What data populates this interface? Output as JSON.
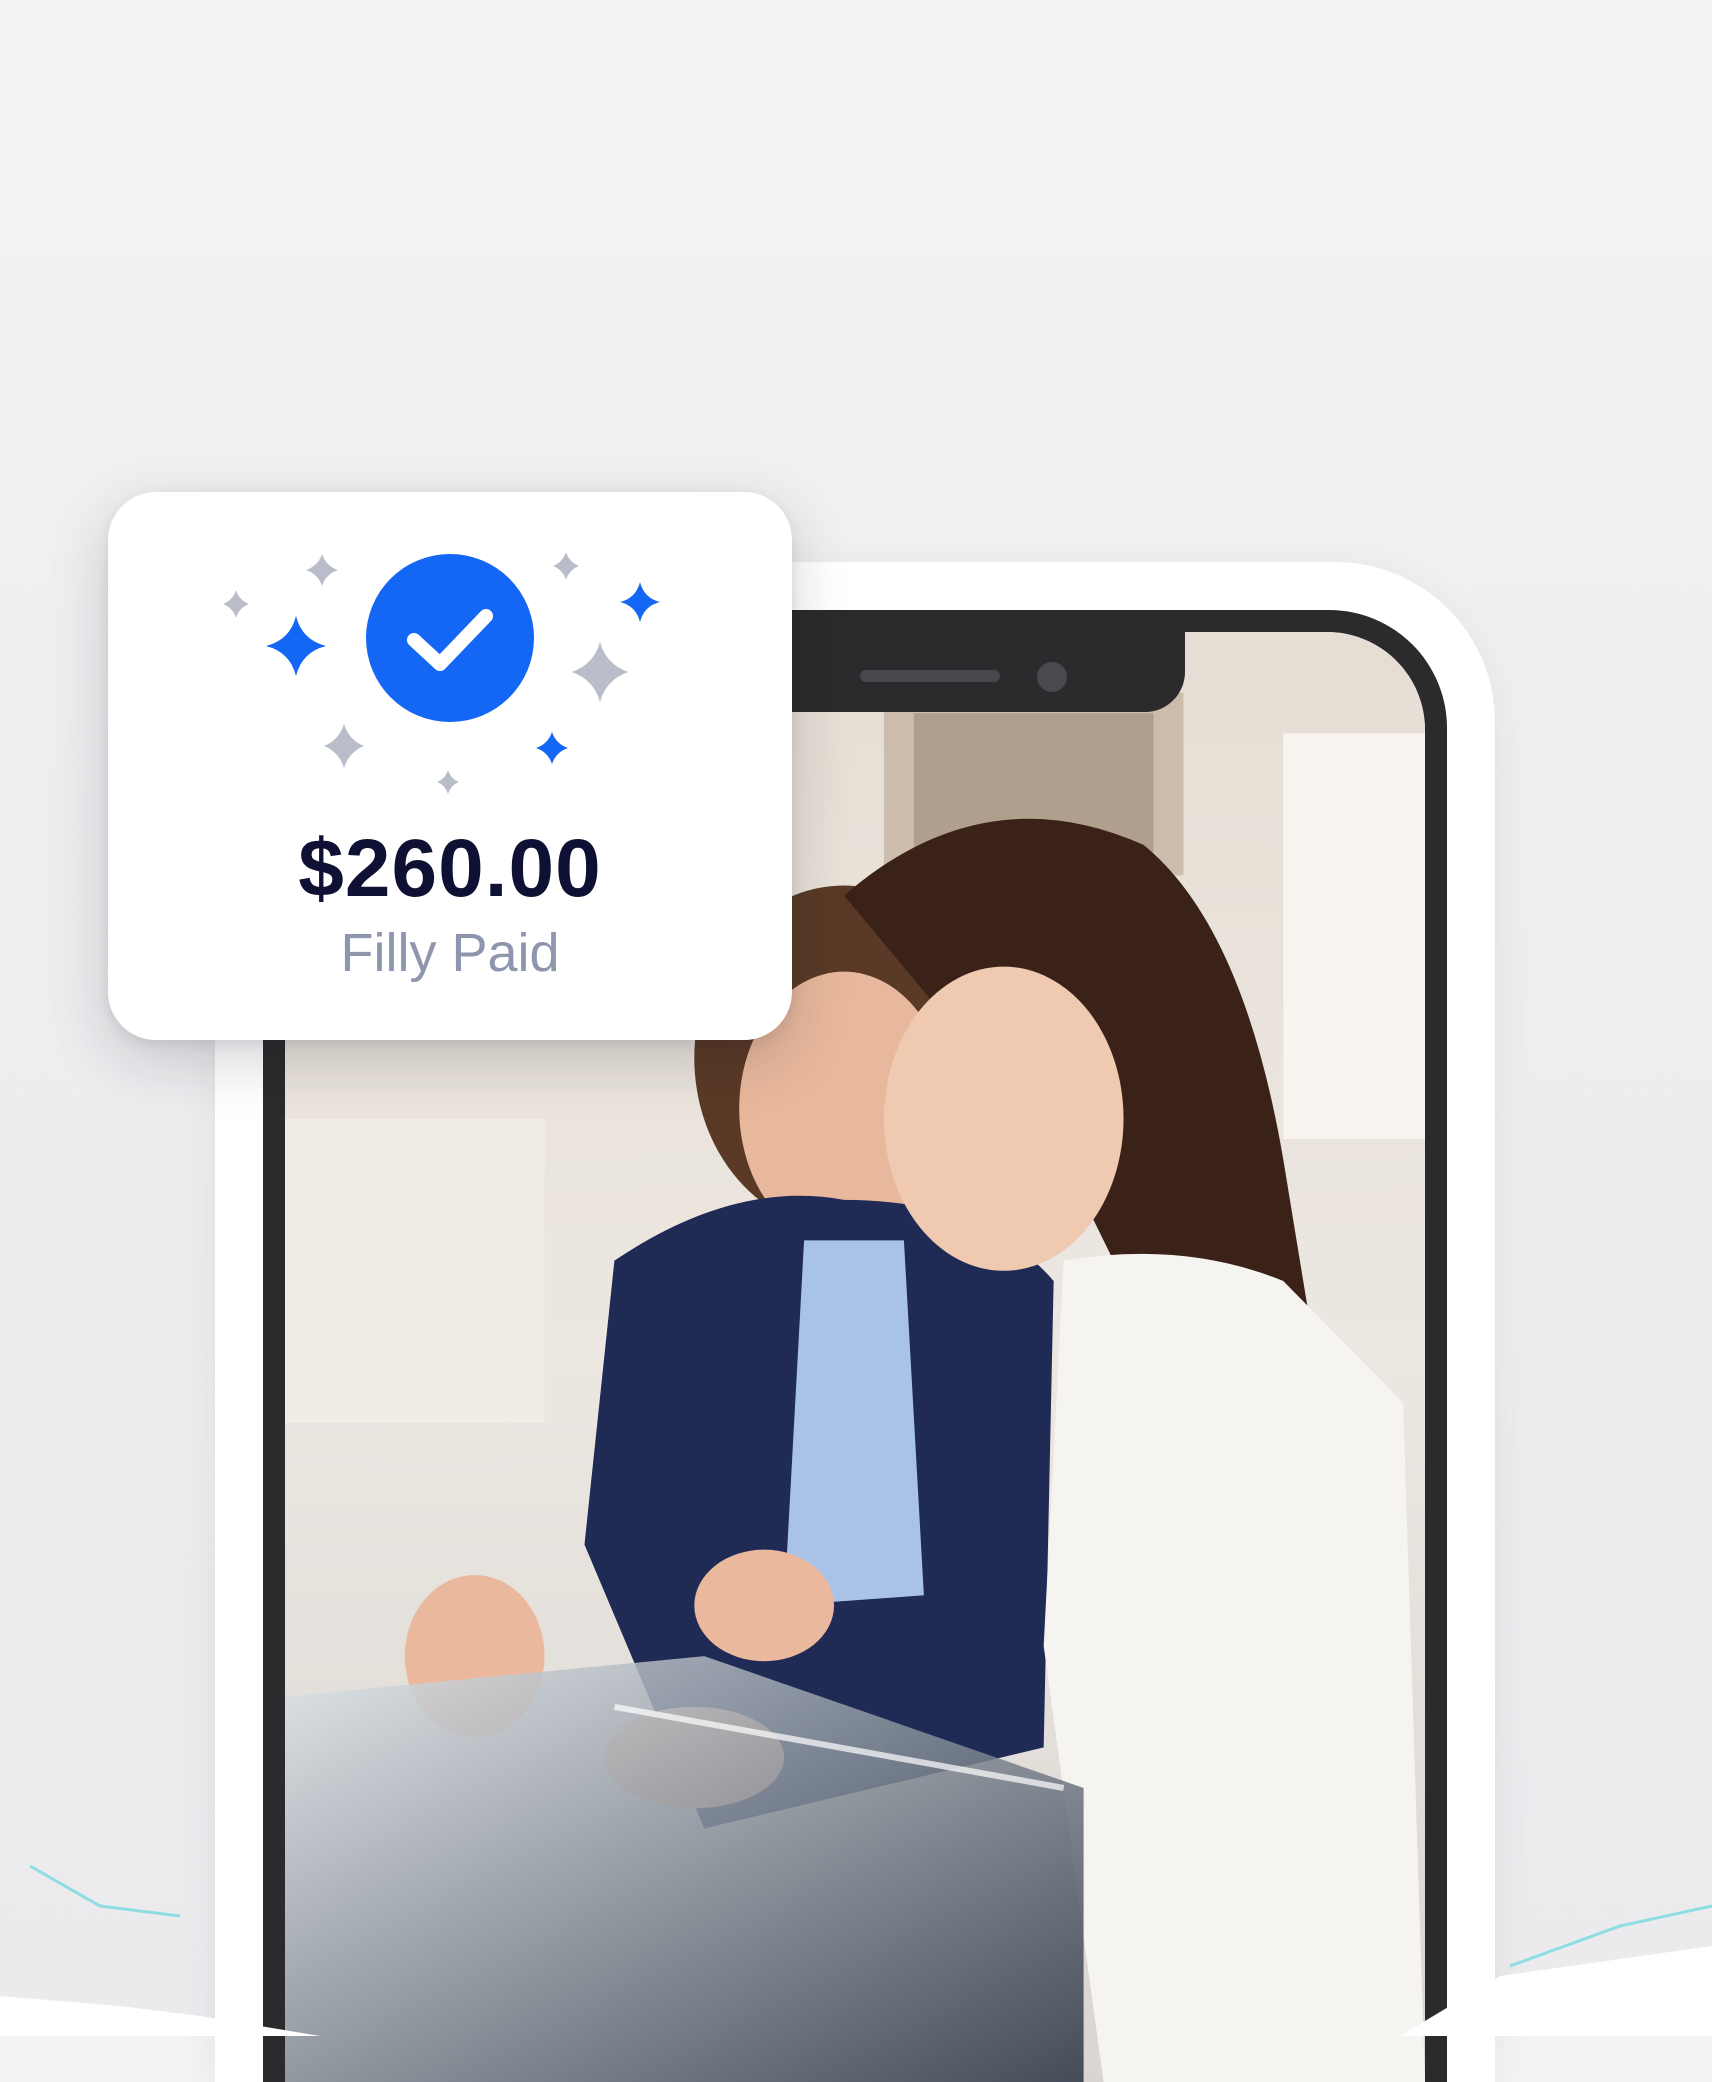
{
  "payment_card": {
    "amount": "$260.00",
    "status": "Filly Paid",
    "icon": "check-circle-icon",
    "accent_color": "#1466f5",
    "sparkle_colors": [
      "#1466f5",
      "#b9bdca"
    ]
  },
  "phone": {
    "photo": "two women looking at jewelry in a display case"
  }
}
